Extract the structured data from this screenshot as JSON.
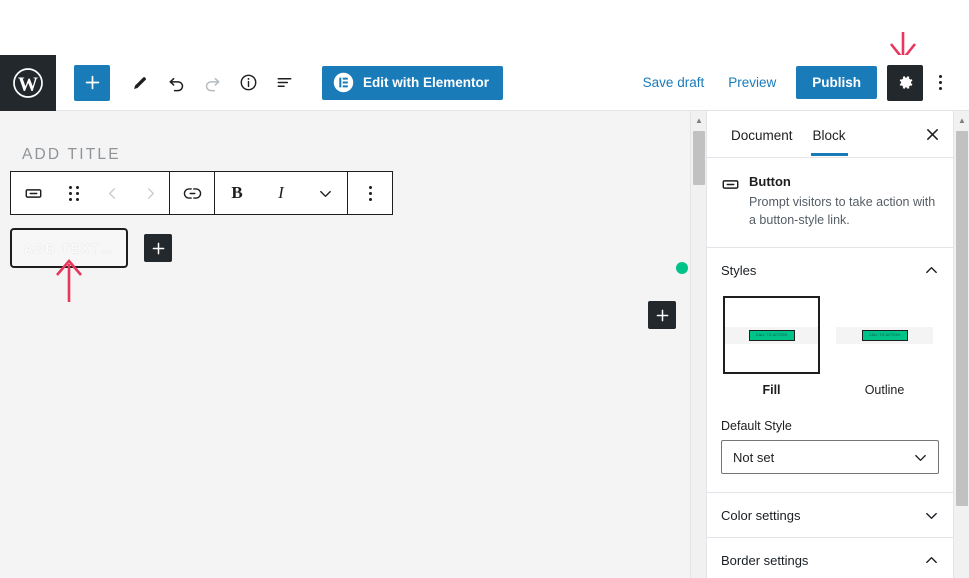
{
  "topbar": {
    "logo_icon": "wordpress-logo-icon",
    "add_block_icon": "plus-icon",
    "edit_icon": "pencil-icon",
    "undo_icon": "undo-arrow-icon",
    "redo_icon": "redo-arrow-icon",
    "info_icon": "info-circle-icon",
    "outline_icon": "block-navigation-icon",
    "elementor_label": "Edit with Elementor",
    "elementor_icon": "elementor-logo-icon",
    "save_draft_label": "Save draft",
    "preview_label": "Preview",
    "publish_label": "Publish",
    "settings_icon": "gear-icon",
    "more_icon": "more-vertical-icon",
    "accent_blue": "#1a7bb9",
    "dark": "#23282d"
  },
  "canvas": {
    "title_placeholder": "ADD TITLE",
    "button_placeholder": "ADD TEXT…",
    "inserter_label": "+",
    "saved_dot_color": "#00c389",
    "block_toolbar": {
      "block_type_icon": "button-block-icon",
      "drag_handle_icon": "drag-handle-icon",
      "move_up_icon": "chevron-left-icon",
      "move_down_icon": "chevron-right-icon",
      "link_icon": "link-icon",
      "bold_label": "B",
      "italic_label": "I",
      "more_rich_text_icon": "chevron-down-icon",
      "options_icon": "more-vertical-icon"
    }
  },
  "sidebar": {
    "tabs": [
      {
        "label": "Document",
        "active": false
      },
      {
        "label": "Block",
        "active": true
      }
    ],
    "close_icon": "close-icon",
    "block_card": {
      "icon": "button-block-icon",
      "title": "Button",
      "description": "Prompt visitors to take action with a button-style link."
    },
    "panels": [
      {
        "title": "Styles",
        "expanded": true,
        "chevron": "chevron-up-icon"
      },
      {
        "title": "Color settings",
        "expanded": false,
        "chevron": "chevron-down-icon"
      },
      {
        "title": "Border settings",
        "expanded": true,
        "chevron": "chevron-up-icon"
      }
    ],
    "styles": {
      "options": [
        {
          "label": "Fill",
          "selected": true,
          "preview_button_text": "CALL TO ACTION"
        },
        {
          "label": "Outline",
          "selected": false,
          "preview_button_text": "CALL TO ACTION"
        }
      ],
      "preview_button_color": "#00c389",
      "default_style_label": "Default Style",
      "default_style_value": "Not set",
      "default_style_chevron": "chevron-down-icon"
    }
  },
  "annotations": {
    "arrow_color": "#e8365d",
    "top_arrow": "down-arrow-annotation",
    "bottom_arrow": "up-arrow-annotation"
  }
}
